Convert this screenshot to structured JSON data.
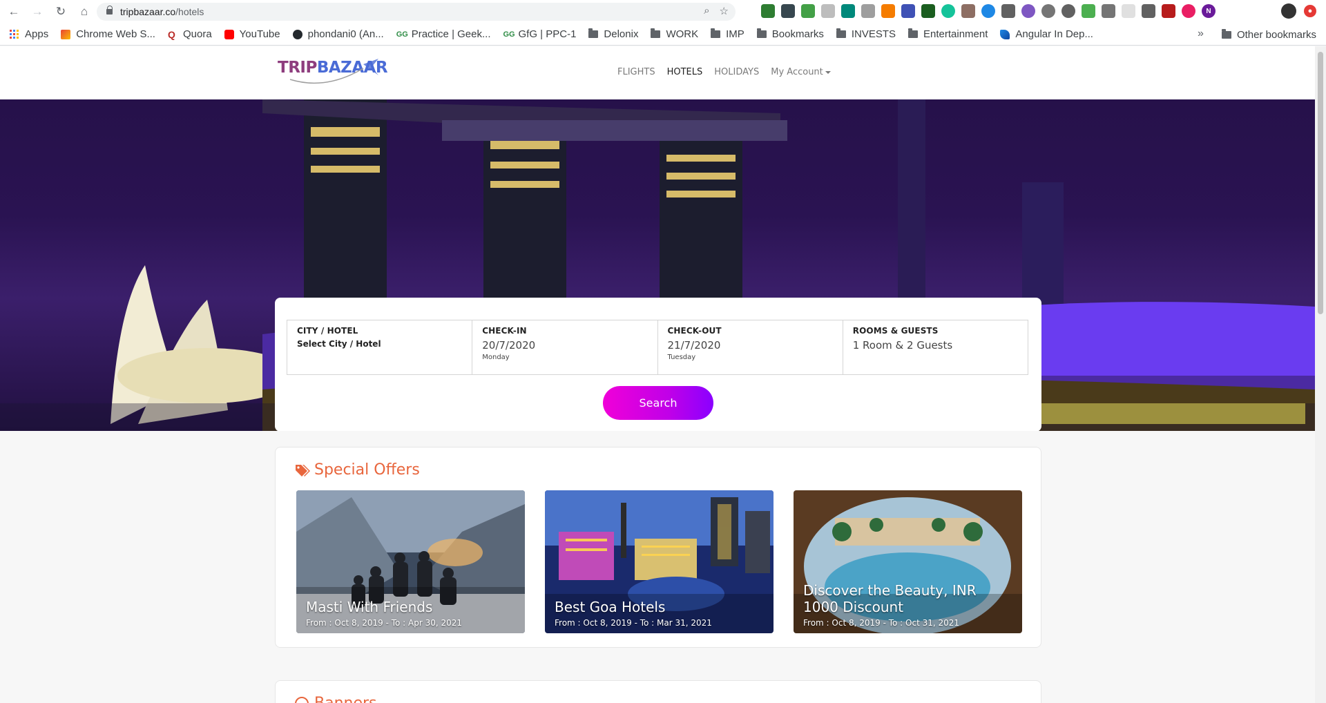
{
  "browser": {
    "url_host": "tripbazaar.co",
    "url_path": "/hotels",
    "bookmarks": [
      {
        "label": "Apps",
        "icon": "apps-grid-icon"
      },
      {
        "label": "Chrome Web S...",
        "icon": "chrome-web-store-icon"
      },
      {
        "label": "Quora",
        "icon": "quora-icon"
      },
      {
        "label": "YouTube",
        "icon": "youtube-icon"
      },
      {
        "label": "phondani0 (An...",
        "icon": "github-icon"
      },
      {
        "label": "Practice | Geek...",
        "icon": "geeksforgeeks-icon"
      },
      {
        "label": "GfG | PPC-1",
        "icon": "geeksforgeeks-icon"
      },
      {
        "label": "Delonix",
        "icon": "folder-icon"
      },
      {
        "label": "WORK",
        "icon": "folder-icon"
      },
      {
        "label": "IMP",
        "icon": "folder-icon"
      },
      {
        "label": "Bookmarks",
        "icon": "folder-icon"
      },
      {
        "label": "INVESTS",
        "icon": "folder-icon"
      },
      {
        "label": "Entertainment",
        "icon": "folder-icon"
      },
      {
        "label": "Angular In Dep...",
        "icon": "angular-in-depth-icon"
      }
    ],
    "overflow": "»",
    "other_bookmarks": "Other bookmarks",
    "profile_letter": "N"
  },
  "site": {
    "logo_part1": "TRIP",
    "logo_part2": "BAZAAR",
    "nav": {
      "flights": "FLIGHTS",
      "hotels": "HOTELS",
      "holidays": "HOLIDAYS",
      "account": "My Account"
    }
  },
  "search": {
    "city_label": "CITY / HOTEL",
    "city_value": "Select City / Hotel",
    "checkin_label": "CHECK-IN",
    "checkin_date": "20/7/2020",
    "checkin_day": "Monday",
    "checkout_label": "CHECK-OUT",
    "checkout_date": "21/7/2020",
    "checkout_day": "Tuesday",
    "guests_label": "ROOMS & GUESTS",
    "guests_value": "1 Room & 2 Guests",
    "button": "Search"
  },
  "offers": {
    "title": "Special Offers",
    "items": [
      {
        "title": "Masti With Friends",
        "dates": "From : Oct 8, 2019 - To : Apr 30, 2021"
      },
      {
        "title": "Best Goa Hotels",
        "dates": "From : Oct 8, 2019 - To : Mar 31, 2021"
      },
      {
        "title": "Discover the Beauty, INR 1000 Discount",
        "dates": "From : Oct 8, 2019 - To : Oct 31, 2021"
      }
    ]
  },
  "banners": {
    "title": "Banners"
  },
  "colors": {
    "accent": "#e8663d",
    "button_start": "#f000d8",
    "button_end": "#8a00ff"
  }
}
